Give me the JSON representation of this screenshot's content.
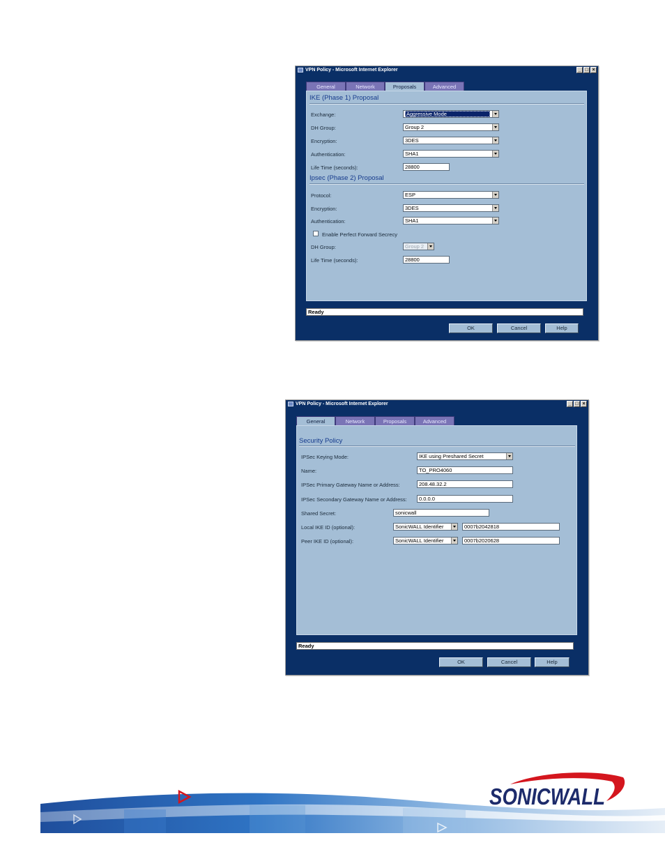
{
  "window1": {
    "title": "VPN Policy - Microsoft Internet Explorer",
    "controls": [
      "_",
      "□",
      "×"
    ],
    "tabs": [
      "General",
      "Network",
      "Proposals",
      "Advanced"
    ],
    "ike_title": "IKE (Phase 1) Proposal",
    "ipsec_title": "Ipsec (Phase 2) Proposal",
    "ike": {
      "exchange_label": "Exchange:",
      "exchange_value": "Aggressive Mode",
      "dh_label": "DH Group:",
      "dh_value": "Group 2",
      "enc_label": "Encryption:",
      "enc_value": "3DES",
      "auth_label": "Authentication:",
      "auth_value": "SHA1",
      "life_label": "Life Time (seconds):",
      "life_value": "28800"
    },
    "ipsec": {
      "proto_label": "Protocol:",
      "proto_value": "ESP",
      "enc_label": "Encryption:",
      "enc_value": "3DES",
      "auth_label": "Authentication:",
      "auth_value": "SHA1",
      "pfs_label": "Enable Perfect Forward Secrecy",
      "dh_label": "DH Group:",
      "dh_value": "Group 2",
      "life_label": "Life Time (seconds):",
      "life_value": "28800"
    },
    "status": "Ready",
    "buttons": {
      "ok": "OK",
      "cancel": "Cancel",
      "help": "Help"
    }
  },
  "window2": {
    "title": "VPN Policy - Microsoft Internet Explorer",
    "controls": [
      "_",
      "□",
      "×"
    ],
    "tabs": [
      "General",
      "Network",
      "Proposals",
      "Advanced"
    ],
    "section_title": "Security Policy",
    "fields": {
      "keying_label": "IPSec Keying Mode:",
      "keying_value": "IKE using Preshared Secret",
      "name_label": "Name:",
      "name_value": "TO_PRO4060",
      "primary_label": "IPSec Primary Gateway Name or Address:",
      "primary_value": "208.48.32.2",
      "secondary_label": "IPSec Secondary Gateway Name or Address:",
      "secondary_value": "0.0.0.0",
      "secret_label": "Shared Secret:",
      "secret_value": "sonicwall",
      "local_label": "Local IKE ID (optional):",
      "local_type": "SonicWALL Identifier",
      "local_value": "0007b2042818",
      "peer_label": "Peer IKE ID (optional):",
      "peer_type": "SonicWALL Identifier",
      "peer_value": "0007b2020628"
    },
    "status": "Ready",
    "buttons": {
      "ok": "OK",
      "cancel": "Cancel",
      "help": "Help"
    }
  },
  "brand": {
    "logo_text": "SONICWALL",
    "navy": "#1d2b6b",
    "red": "#d4161e"
  }
}
